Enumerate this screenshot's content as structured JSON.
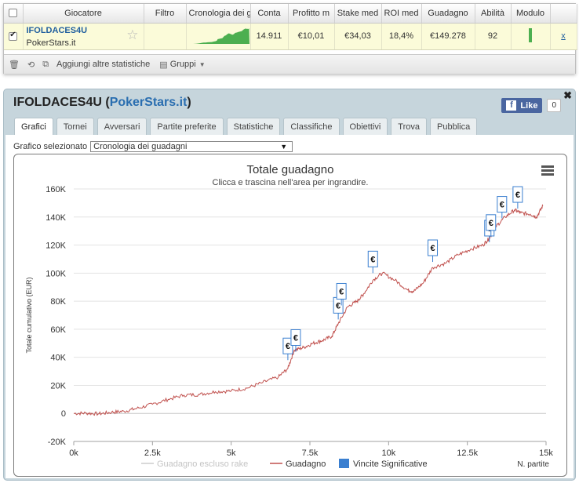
{
  "grid": {
    "headers": [
      "Giocatore",
      "Filtro",
      "Cronologia dei g",
      "Conta",
      "Profitto m",
      "Stake med",
      "ROI med",
      "Guadagno",
      "Abilità",
      "Modulo"
    ],
    "row": {
      "player": "IFOLDACES4U",
      "site": "PokerStars.it",
      "count": "14.911",
      "avg_profit": "€10,01",
      "avg_stake": "€34,03",
      "avg_roi": "18,4%",
      "winnings": "€149.278",
      "ability": "92",
      "remove": "x"
    },
    "toolbar": {
      "add_stats": "Aggiungi altre statistiche",
      "groups": "Gruppi"
    }
  },
  "panel": {
    "title_player": "IFOLDACES4U",
    "title_site": "PokerStars.it",
    "like_label": "Like",
    "like_count": "0",
    "tabs": [
      "Grafici",
      "Tornei",
      "Avversari",
      "Partite preferite",
      "Statistiche",
      "Classifiche",
      "Obiettivi",
      "Trova",
      "Pubblica"
    ],
    "active_tab": 0,
    "selector_label": "Grafico selezionato",
    "selector_value": "Cronologia dei guadagni"
  },
  "colors": {
    "accent_blue": "#2a6eb0",
    "series_line": "#c0504d",
    "rake_line": "#d9d9d9",
    "flag_blue": "#3a7fd0",
    "highlight_row": "#fbfbd9",
    "module_green": "#4caf50"
  },
  "chart_data": {
    "type": "line",
    "title": "Totale guadagno",
    "subtitle": "Clicca e trascina nell'area per ingrandire.",
    "ylabel": "Totale cumulativo (EUR)",
    "xlabel": "N. partite",
    "xlim": [
      0,
      15000
    ],
    "ylim": [
      -20000,
      160000
    ],
    "x_ticks": [
      0,
      2500,
      5000,
      7500,
      10000,
      12500,
      15000
    ],
    "x_tick_labels": [
      "0k",
      "2.5k",
      "5k",
      "7.5k",
      "10k",
      "12.5k",
      "15k"
    ],
    "y_ticks": [
      -20000,
      0,
      20000,
      40000,
      60000,
      80000,
      100000,
      120000,
      140000,
      160000
    ],
    "y_tick_labels": [
      "-20K",
      "0",
      "20K",
      "40K",
      "60K",
      "80K",
      "100K",
      "120K",
      "140K",
      "160K"
    ],
    "grid": true,
    "legend_position": "bottom",
    "series": [
      {
        "name": "Guadagno escluso rake",
        "visible": false,
        "x": [],
        "values": []
      },
      {
        "name": "Guadagno",
        "x": [
          0,
          400,
          800,
          1200,
          1600,
          2000,
          2500,
          3000,
          3500,
          4000,
          4500,
          5000,
          5500,
          6000,
          6500,
          6800,
          7000,
          7300,
          7600,
          7900,
          8200,
          8400,
          8700,
          9000,
          9200,
          9500,
          9800,
          10200,
          10600,
          10800,
          11100,
          11400,
          11800,
          12200,
          12600,
          13000,
          13200,
          13400,
          13700,
          14000,
          14200,
          14500,
          14700,
          14900
        ],
        "values": [
          0,
          200,
          -300,
          800,
          1500,
          3500,
          6500,
          10000,
          13000,
          13500,
          15500,
          16000,
          18000,
          22000,
          26000,
          32000,
          45000,
          47000,
          50000,
          52000,
          55000,
          64000,
          76000,
          80000,
          85000,
          95000,
          100000,
          95000,
          88000,
          87000,
          93000,
          104000,
          107000,
          113000,
          117000,
          120000,
          125000,
          133000,
          140000,
          145000,
          143000,
          142000,
          140000,
          148000
        ]
      }
    ],
    "flags": {
      "name": "Vincite Significative",
      "label": "€",
      "points": [
        {
          "x": 6800,
          "y": 38000
        },
        {
          "x": 7050,
          "y": 44000
        },
        {
          "x": 8400,
          "y": 67000
        },
        {
          "x": 8500,
          "y": 77000
        },
        {
          "x": 9500,
          "y": 100000
        },
        {
          "x": 11400,
          "y": 108000
        },
        {
          "x": 13200,
          "y": 122000
        },
        {
          "x": 13250,
          "y": 126000
        },
        {
          "x": 13600,
          "y": 139000
        },
        {
          "x": 14100,
          "y": 146000
        }
      ]
    }
  }
}
